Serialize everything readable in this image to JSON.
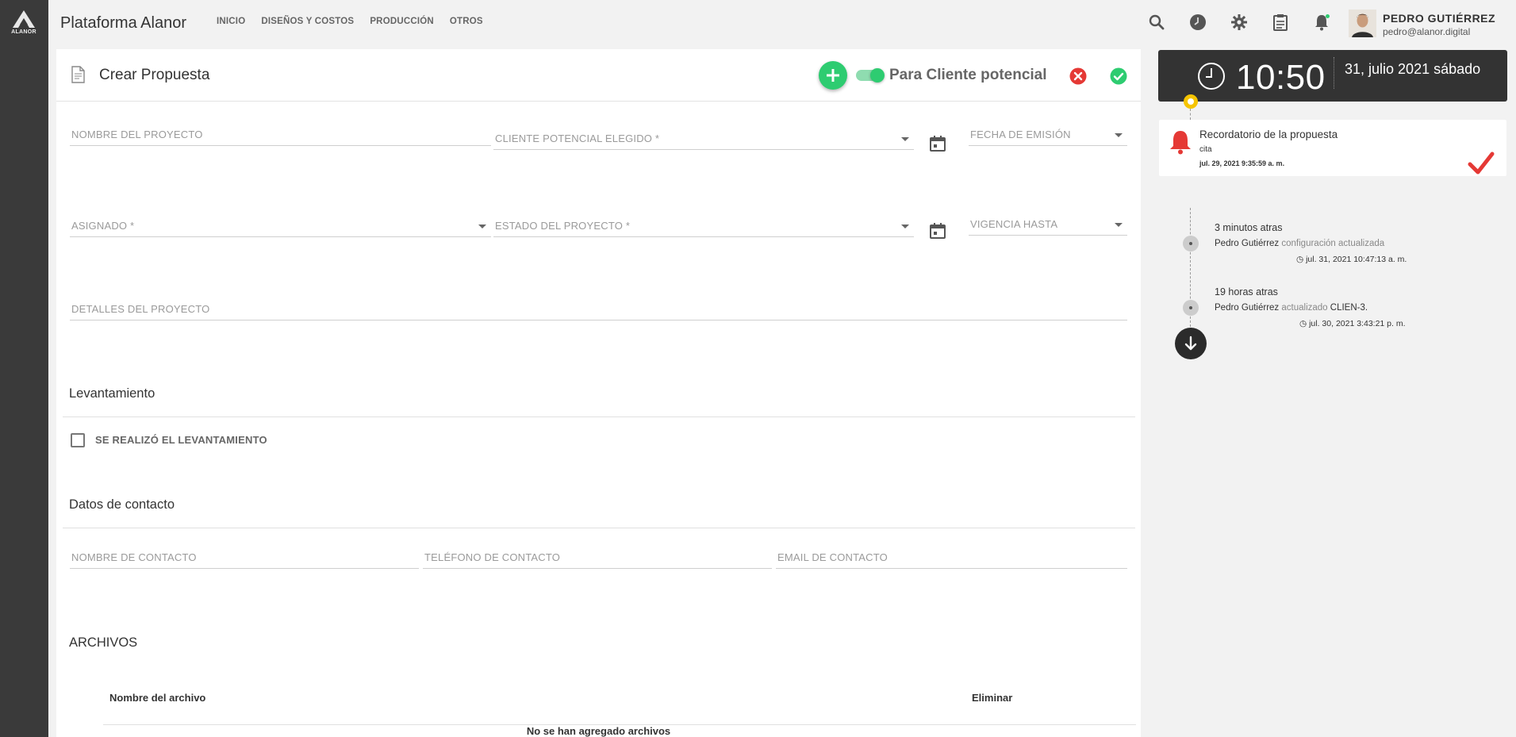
{
  "app": {
    "logo_text": "ALANOR",
    "title": "Plataforma Alanor",
    "nav": [
      "INICIO",
      "DISEÑOS Y COSTOS",
      "PRODUCCIÓN",
      "OTROS"
    ]
  },
  "topbar": {
    "icons": [
      "search-icon",
      "clock-icon",
      "gear-icon",
      "clipboard-icon",
      "bell-icon"
    ],
    "user": {
      "name": "PEDRO GUTIÉRREZ",
      "email": "pedro@alanor.digital"
    }
  },
  "form": {
    "title": "Crear Propuesta",
    "toggle_label": "Para Cliente potencial",
    "toggle_on": true,
    "fields": {
      "nombre_proyecto": "NOMBRE DEL PROYECTO",
      "cliente_potencial": "CLIENTE POTENCIAL ELEGIDO *",
      "fecha_emision": "FECHA DE EMISIÓN",
      "asignado": "ASIGNADO *",
      "estado_proyecto": "ESTADO DEL PROYECTO *",
      "vigencia_hasta": "VIGENCIA HASTA",
      "detalles_proyecto": "DETALLES DEL PROYECTO"
    },
    "levantamiento": {
      "title": "Levantamiento",
      "checkbox_label": "SE REALIZÓ EL LEVANTAMIENTO",
      "checked": false
    },
    "contacto": {
      "title": "Datos de contacto",
      "nombre": "NOMBRE DE CONTACTO",
      "telefono": "TELÉFONO DE CONTACTO",
      "email": "EMAIL DE CONTACTO"
    },
    "archivos": {
      "title": "ARCHIVOS",
      "col_name": "Nombre del archivo",
      "col_delete": "Eliminar",
      "empty": "No se han agregado archivos"
    }
  },
  "clock": {
    "time": "10:50",
    "date": "31, julio 2021 sábado"
  },
  "reminder": {
    "title": "Recordatorio de la propuesta",
    "subtitle": "cita",
    "date": "jul. 29, 2021 9:35:59 a. m."
  },
  "timeline": [
    {
      "when": "3 minutos atras",
      "user": "Pedro Gutiérrez",
      "action": "configuración actualizada",
      "extra": "",
      "stamp": "jul. 31, 2021 10:47:13 a. m."
    },
    {
      "when": "19 horas atras",
      "user": "Pedro Gutiérrez",
      "action": "actualizado",
      "extra": "CLIEN-3.",
      "stamp": "jul. 30, 2021 3:43:21 p. m."
    }
  ],
  "colors": {
    "accent": "#2ecc71",
    "danger": "#e53935",
    "dark": "#333333",
    "timeline_marker": "#f5c400"
  }
}
